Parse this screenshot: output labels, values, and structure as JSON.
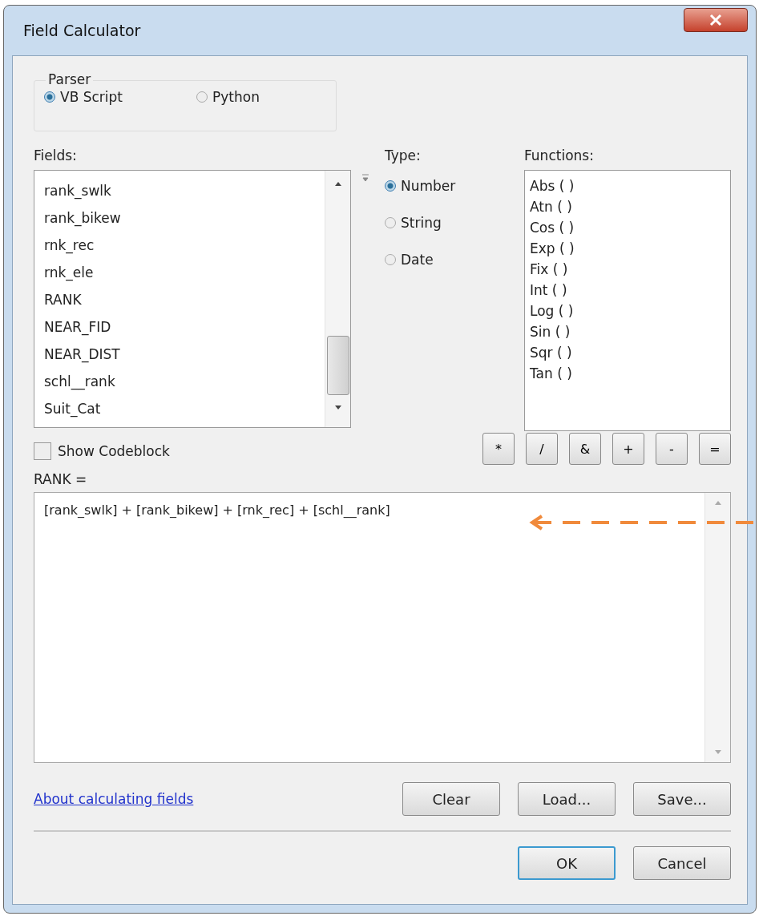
{
  "window": {
    "title": "Field Calculator"
  },
  "parser": {
    "label": "Parser",
    "options": [
      {
        "label": "VB Script",
        "selected": true
      },
      {
        "label": "Python",
        "selected": false
      }
    ]
  },
  "fields": {
    "label": "Fields:",
    "items": [
      "rank_swlk",
      "rank_bikew",
      "rnk_rec",
      "rnk_ele",
      "RANK",
      "NEAR_FID",
      "NEAR_DIST",
      "schl__rank",
      "Suit_Cat"
    ]
  },
  "type": {
    "label": "Type:",
    "options": [
      {
        "label": "Number",
        "selected": true
      },
      {
        "label": "String",
        "selected": false
      },
      {
        "label": "Date",
        "selected": false
      }
    ]
  },
  "functions": {
    "label": "Functions:",
    "items": [
      "Abs ( )",
      "Atn ( )",
      "Cos ( )",
      "Exp ( )",
      "Fix ( )",
      "Int ( )",
      "Log ( )",
      "Sin ( )",
      "Sqr ( )",
      "Tan ( )"
    ]
  },
  "show_codeblock": {
    "label": "Show Codeblock",
    "checked": false
  },
  "operators": [
    "*",
    "/",
    "&",
    "+",
    "-",
    "="
  ],
  "expression": {
    "label": "RANK =",
    "value": "[rank_swlk] + [rank_bikew] + [rnk_rec] + [schl__rank]"
  },
  "help_link": "About calculating fields",
  "file_buttons": [
    "Clear",
    "Load...",
    "Save..."
  ],
  "dialog_buttons": [
    {
      "label": "OK",
      "default": true
    },
    {
      "label": "Cancel",
      "default": false
    }
  ]
}
